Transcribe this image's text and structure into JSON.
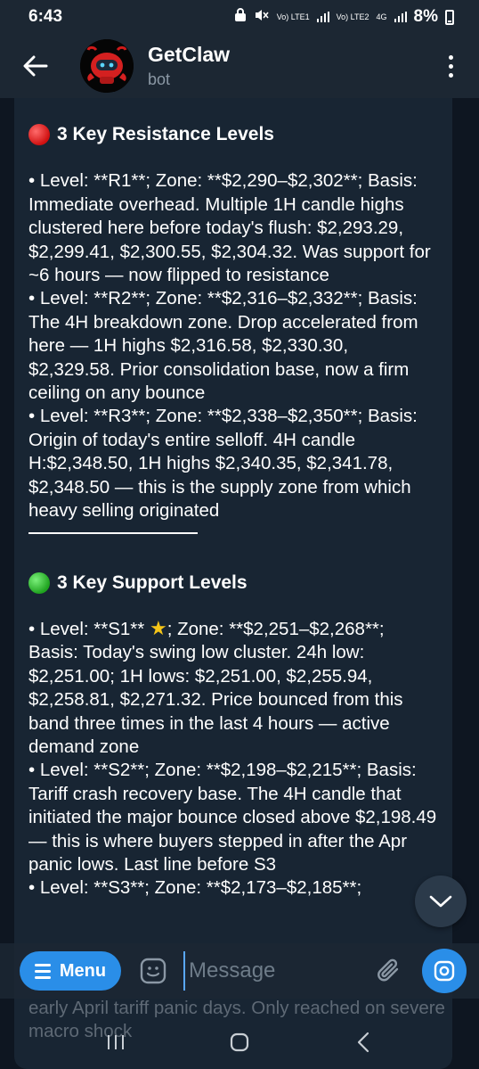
{
  "status": {
    "time": "6:43",
    "sim1": "Vo) LTE1",
    "sim2": "Vo) LTE2",
    "network": "4G",
    "battery": "8%"
  },
  "header": {
    "title": "GetClaw",
    "subtitle": "bot"
  },
  "message": {
    "resistance_title": "3 Key Resistance Levels",
    "resistance_items": [
      "• Level: **R1**; Zone: **$2,290–$2,302**; Basis: Immediate overhead. Multiple 1H candle highs clustered here before today's flush: $2,293.29, $2,299.41, $2,300.55, $2,304.32. Was support for ~6 hours — now flipped to resistance",
      "• Level: **R2**; Zone: **$2,316–$2,332**; Basis: The 4H breakdown zone. Drop accelerated from here — 1H highs $2,316.58, $2,330.30, $2,329.58. Prior consolidation base, now a firm ceiling on any bounce",
      "• Level: **R3**; Zone: **$2,338–$2,350**; Basis: Origin of today's entire selloff. 4H candle H:$2,348.50, 1H highs $2,340.35, $2,341.78, $2,348.50 — this is the supply zone from which heavy selling originated"
    ],
    "separator": "________________",
    "support_title": "3 Key Support Levels",
    "s1_prefix": "• Level: **S1** ",
    "s1_rest": "; Zone: **$2,251–$2,268**; Basis: Today's swing low cluster. 24h low: $2,251.00; 1H lows: $2,251.00, $2,255.94, $2,258.81, $2,271.32. Price bounced from this band three times in the last 4 hours — active demand zone",
    "s2": "• Level: **S2**; Zone: **$2,198–$2,215**; Basis: Tariff crash recovery base. The 4H candle that initiated the major bounce closed above $2,198.49 — this is where buyers stepped in after the Apr panic lows. Last line before S3",
    "s3": "• Level: **S3**; Zone: **$2,173–$2,185**;",
    "below_input": "early April tariff panic days. Only reached on severe macro shock"
  },
  "input": {
    "menu_label": "Menu",
    "placeholder": "Message"
  },
  "colors": {
    "accent": "#2a8ee8",
    "bubble": "#182533",
    "background": "#0e1621",
    "header": "#1c2733"
  },
  "icons": [
    "back-arrow-icon",
    "bot-avatar-icon",
    "more-vert-icon",
    "chevron-down-icon",
    "menu-icon",
    "sticker-icon",
    "attach-icon",
    "camera-icon",
    "recents-icon",
    "home-icon",
    "back-nav-icon"
  ]
}
